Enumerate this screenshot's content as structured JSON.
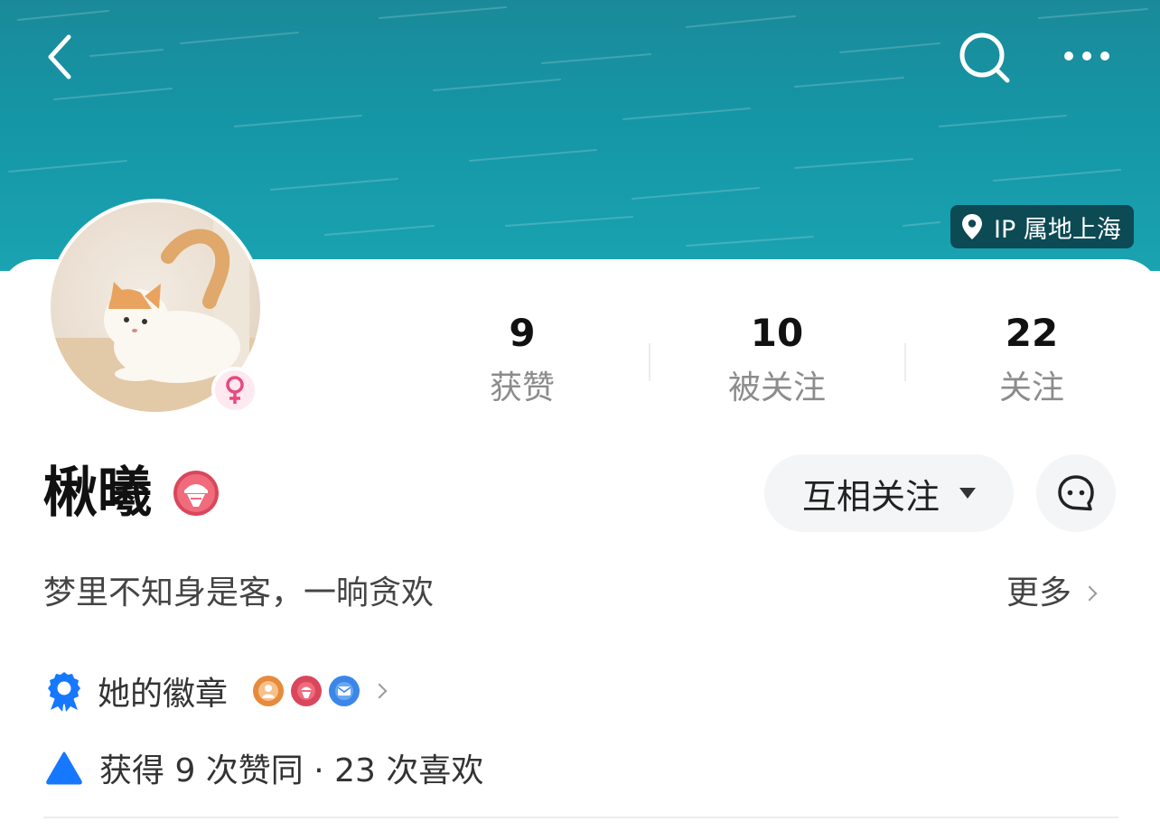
{
  "header": {
    "back_icon": "chevron-left-icon",
    "search_icon": "search-icon",
    "more_icon": "more-horizontal-icon",
    "ip_location": "IP 属地上海"
  },
  "profile": {
    "username": "楸曦",
    "gender": "female",
    "bio": "梦里不知身是客，一晌贪欢",
    "more_label": "更多"
  },
  "stats": [
    {
      "value": "9",
      "label": "获赞"
    },
    {
      "value": "10",
      "label": "被关注"
    },
    {
      "value": "22",
      "label": "关注"
    }
  ],
  "actions": {
    "follow_label": "互相关注"
  },
  "badges": {
    "label": "她的徽章",
    "items": [
      "person-badge-icon",
      "sticker-badge-icon",
      "message-badge-icon"
    ]
  },
  "summary": {
    "text": "获得 9 次赞同 · 23 次喜欢"
  },
  "colors": {
    "accent_blue": "#1677ff",
    "banner_teal": "#1596a6",
    "female_pink": "#e8497e"
  }
}
